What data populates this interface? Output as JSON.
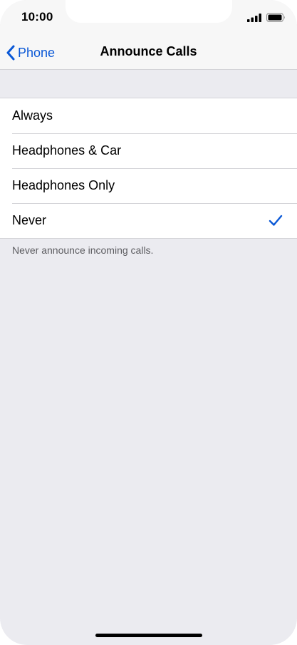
{
  "status_bar": {
    "time": "10:00"
  },
  "nav": {
    "back_label": "Phone",
    "title": "Announce Calls"
  },
  "options": [
    {
      "label": "Always",
      "selected": false
    },
    {
      "label": "Headphones & Car",
      "selected": false
    },
    {
      "label": "Headphones Only",
      "selected": false
    },
    {
      "label": "Never",
      "selected": true
    }
  ],
  "footer_note": "Never announce incoming calls.",
  "colors": {
    "accent": "#0a58d6",
    "background": "#ebebf0",
    "cell_background": "#ffffff"
  },
  "icons": {
    "back": "chevron-left-icon",
    "selected": "checkmark-icon",
    "signal": "cellular-signal-icon",
    "battery": "battery-icon"
  }
}
